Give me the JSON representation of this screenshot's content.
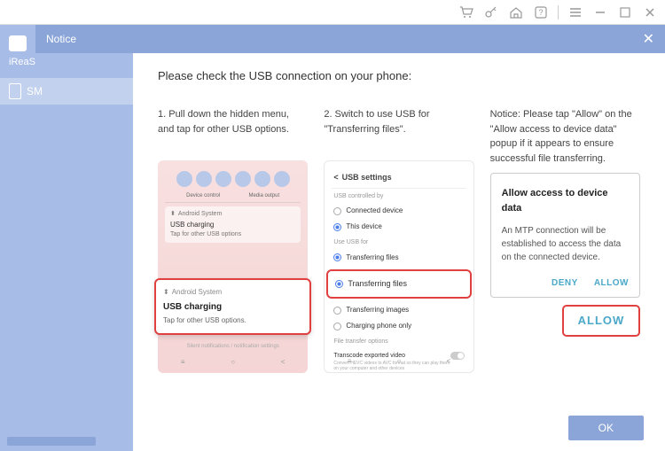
{
  "titlebar": {
    "icons": [
      "cart-icon",
      "key-icon",
      "home-icon",
      "help-icon",
      "menu-icon",
      "minimize-icon",
      "maximize-icon",
      "close-icon"
    ]
  },
  "sidebar": {
    "brand": "iReaS",
    "items": [
      {
        "label": "SM"
      }
    ]
  },
  "notice": {
    "title": "Notice",
    "heading": "Please check the USB connection on your phone:"
  },
  "steps": [
    {
      "text": "1. Pull down the hidden menu, and tap for other USB options.",
      "mock": {
        "qs_labels": [
          "Device control",
          "Media output"
        ],
        "other_notif": "USB charging",
        "other_notif_sub": "Tap for other USB options",
        "system_label": "Android System",
        "notif_title": "USB charging",
        "notif_sub": "Tap for other USB options.",
        "tiny": "Silent notifications / notification settings"
      }
    },
    {
      "text": "2. Switch to use USB for \"Transferring files\".",
      "mock": {
        "header": "USB settings",
        "section1": "USB controlled by",
        "opt_connected": "Connected device",
        "opt_this": "This device",
        "section2": "Use USB for",
        "opt_transfer": "Transferring files",
        "opt_transfer_hl": "Transferring files",
        "opt_images": "Transferring images",
        "opt_charge": "Charging phone only",
        "section3": "File transfer options",
        "transcode_title": "Transcode exported video",
        "transcode_sub": "Convert HEVC videos to AVC format so they can play them on your computer and other devices"
      }
    },
    {
      "text": "Notice: Please tap \"Allow\" on the \"Allow access to device data\" popup if it appears to ensure successful file transferring.",
      "dialog": {
        "title": "Allow access to device data",
        "body": "An MTP connection will be established to access the data on the connected device.",
        "deny": "DENY",
        "allow": "ALLOW",
        "allow_hl": "ALLOW"
      }
    }
  ],
  "ok_button": "OK"
}
